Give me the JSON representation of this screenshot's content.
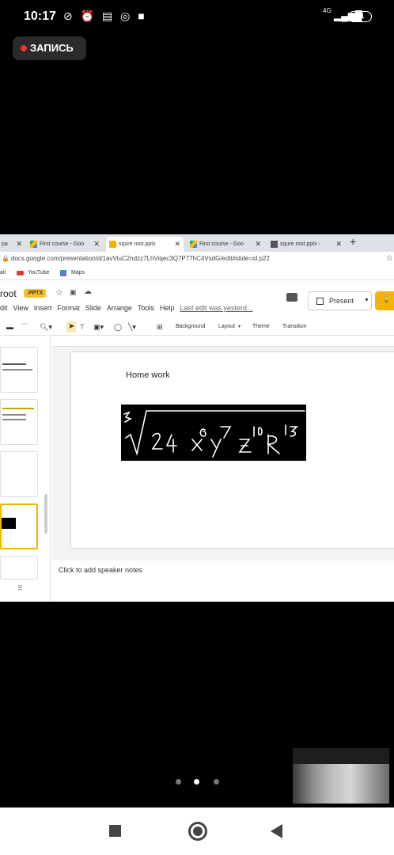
{
  "status_bar": {
    "time": "10:17",
    "network": "4G",
    "battery": "41"
  },
  "recording": {
    "label": "ЗАПИСЬ"
  },
  "browser": {
    "tabs": [
      {
        "label": "pa",
        "active": false
      },
      {
        "label": "First course - Goo",
        "active": false
      },
      {
        "label": "squre root.pptx",
        "active": true
      },
      {
        "label": "First course - Goo",
        "active": false
      },
      {
        "label": "squre root.pptx -",
        "active": false
      }
    ],
    "new_tab": "+",
    "url": "docs.google.com/presentation/d/1avViuC2ndzz7LhViqec3Q7P77hC4VsdG/edit#slide=id.p22",
    "bookmarks": [
      "ail",
      "YouTube",
      "Maps"
    ]
  },
  "slides_app": {
    "doc_title": "root",
    "file_badge": ".PPTX",
    "menus": [
      "dit",
      "View",
      "Insert",
      "Format",
      "Slide",
      "Arrange",
      "Tools",
      "Help"
    ],
    "last_edit": "Last edit was yesterd...",
    "present_label": "Present",
    "toolbar": {
      "background": "Background",
      "layout": "Layout",
      "theme": "Theme",
      "transition": "Transition"
    },
    "slide": {
      "title": "Home work"
    },
    "speaker_notes_placeholder": "Click to add speaker notes"
  }
}
